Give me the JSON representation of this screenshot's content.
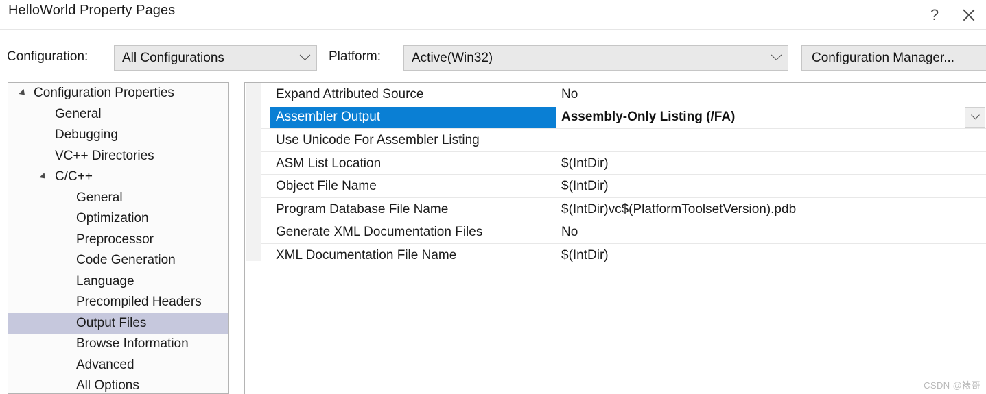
{
  "window": {
    "title": "HelloWorld Property Pages",
    "help_label": "?",
    "close_label": "close-icon"
  },
  "config_bar": {
    "configuration_label": "Configuration:",
    "configuration_value": "All Configurations",
    "platform_label": "Platform:",
    "platform_value": "Active(Win32)",
    "configuration_manager_button": "Configuration Manager..."
  },
  "tree": {
    "items": [
      {
        "label": "Configuration Properties",
        "depth": 0,
        "expander": true,
        "selected": false
      },
      {
        "label": "General",
        "depth": 1,
        "expander": false,
        "selected": false
      },
      {
        "label": "Debugging",
        "depth": 1,
        "expander": false,
        "selected": false
      },
      {
        "label": "VC++ Directories",
        "depth": 1,
        "expander": false,
        "selected": false
      },
      {
        "label": "C/C++",
        "depth": 1,
        "expander": true,
        "selected": false
      },
      {
        "label": "General",
        "depth": 2,
        "expander": false,
        "selected": false
      },
      {
        "label": "Optimization",
        "depth": 2,
        "expander": false,
        "selected": false
      },
      {
        "label": "Preprocessor",
        "depth": 2,
        "expander": false,
        "selected": false
      },
      {
        "label": "Code Generation",
        "depth": 2,
        "expander": false,
        "selected": false
      },
      {
        "label": "Language",
        "depth": 2,
        "expander": false,
        "selected": false
      },
      {
        "label": "Precompiled Headers",
        "depth": 2,
        "expander": false,
        "selected": false
      },
      {
        "label": "Output Files",
        "depth": 2,
        "expander": false,
        "selected": true
      },
      {
        "label": "Browse Information",
        "depth": 2,
        "expander": false,
        "selected": false
      },
      {
        "label": "Advanced",
        "depth": 2,
        "expander": false,
        "selected": false
      },
      {
        "label": "All Options",
        "depth": 2,
        "expander": false,
        "selected": false
      }
    ]
  },
  "properties": {
    "rows": [
      {
        "name": "Expand Attributed Source",
        "value": "No",
        "selected": false,
        "dropdown": false
      },
      {
        "name": "Assembler Output",
        "value": "Assembly-Only Listing (/FA)",
        "selected": true,
        "dropdown": true
      },
      {
        "name": "Use Unicode For Assembler Listing",
        "value": "",
        "selected": false,
        "dropdown": false
      },
      {
        "name": "ASM List Location",
        "value": "$(IntDir)",
        "selected": false,
        "dropdown": false
      },
      {
        "name": "Object File Name",
        "value": "$(IntDir)",
        "selected": false,
        "dropdown": false
      },
      {
        "name": "Program Database File Name",
        "value": "$(IntDir)vc$(PlatformToolsetVersion).pdb",
        "selected": false,
        "dropdown": false
      },
      {
        "name": "Generate XML Documentation Files",
        "value": "No",
        "selected": false,
        "dropdown": false
      },
      {
        "name": "XML Documentation File Name",
        "value": "$(IntDir)",
        "selected": false,
        "dropdown": false
      }
    ]
  },
  "watermark": {
    "text": "CSDN @裱哥"
  },
  "colors": {
    "selection_blue": "#0a7fd4",
    "tree_selection": "#c6c8dd",
    "control_face": "#e9e9e9",
    "border": "#b4b4b4"
  }
}
